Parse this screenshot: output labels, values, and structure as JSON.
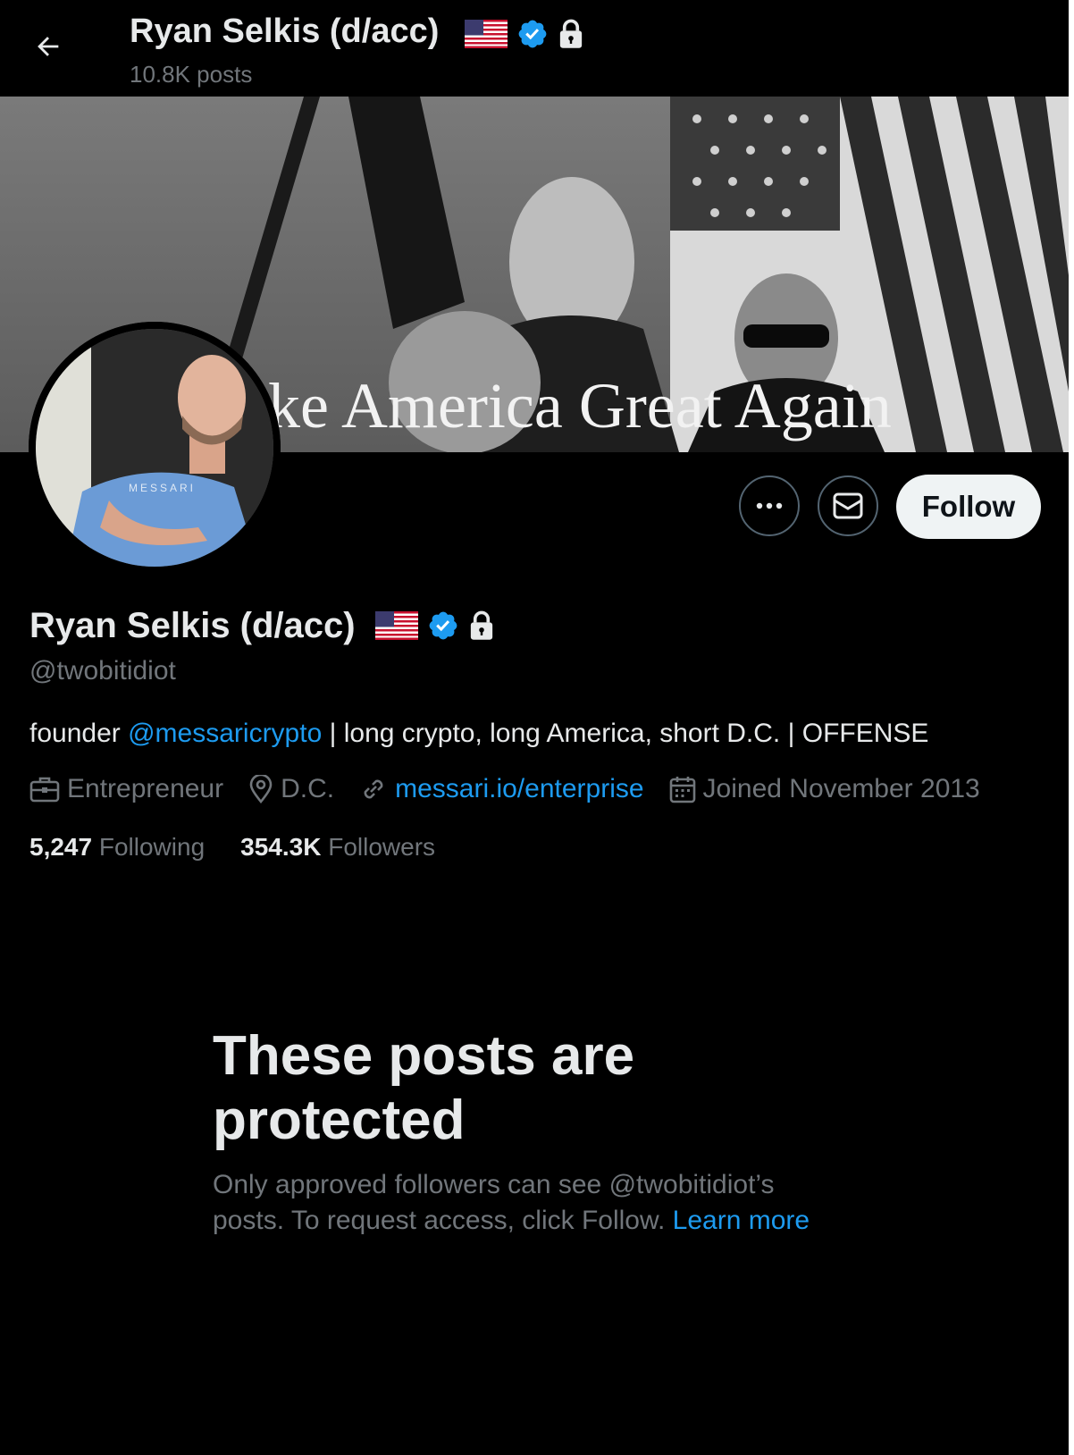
{
  "header": {
    "name": "Ryan Selkis (d/acc)",
    "posts_count": "10.8K posts"
  },
  "banner": {
    "caption": "ke America Great Again"
  },
  "profile": {
    "name": "Ryan Selkis (d/acc)",
    "handle": "@twobitidiot",
    "bio": {
      "prefix": "founder ",
      "mention": "@messaricrypto",
      "suffix": " | long crypto, long America, short D.C. | OFFENSE"
    },
    "meta": {
      "category": "Entrepreneur",
      "location": "D.C.",
      "website": "messari.io/enterprise",
      "joined": "Joined November 2013"
    },
    "following": {
      "value": "5,247",
      "label": "Following"
    },
    "followers": {
      "value": "354.3K",
      "label": "Followers"
    }
  },
  "actions": {
    "follow_label": "Follow"
  },
  "protected": {
    "title": "These posts are protected",
    "description": "Only approved followers can see @twobitidiot’s posts. To request access, click Follow.",
    "learn_more": "Learn more"
  },
  "colors": {
    "background": "#000000",
    "text_primary": "#e7e9ea",
    "text_secondary": "#71767b",
    "accent_blue": "#1d9bf0",
    "follow_button_bg": "#eff3f4"
  },
  "icons": [
    "back-arrow-icon",
    "us-flag-icon",
    "verified-badge-icon",
    "lock-icon",
    "more-icon",
    "mail-icon",
    "briefcase-icon",
    "location-pin-icon",
    "link-icon",
    "calendar-icon"
  ]
}
